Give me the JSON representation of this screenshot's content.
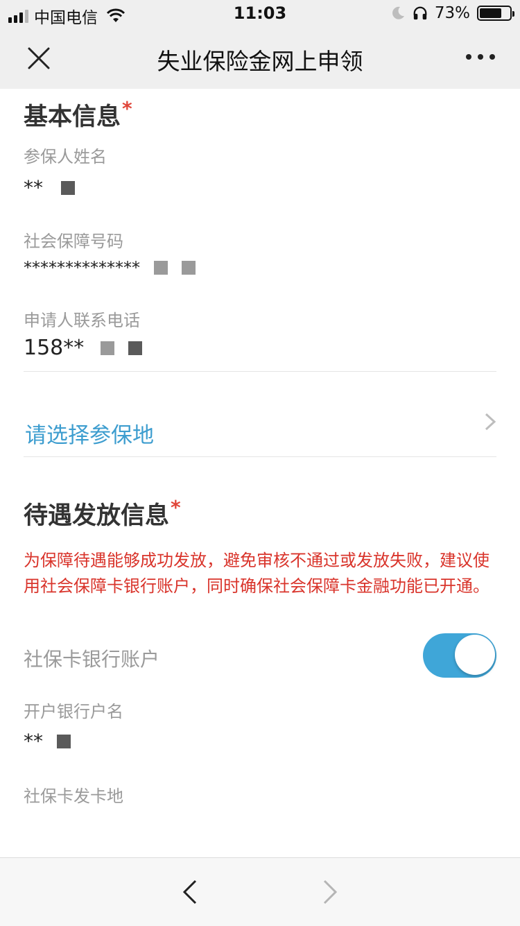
{
  "status_bar": {
    "carrier": "中国电信",
    "time": "11:03",
    "battery_percent": "73%",
    "battery_level": 0.73,
    "icons": [
      "signal-icon",
      "wifi-icon",
      "moon-icon",
      "headphone-icon",
      "battery-icon"
    ]
  },
  "nav": {
    "title": "失业保险金网上申领",
    "close_icon": "close-icon",
    "more_icon": "more-icon"
  },
  "basic_info": {
    "title": "基本信息",
    "required_mark": "*",
    "name_label": "参保人姓名",
    "name_value": "**",
    "ssn_label": "社会保障号码",
    "ssn_value": "**************",
    "phone_label": "申请人联系电话",
    "phone_value": "158**"
  },
  "location_picker": {
    "label": "请选择参保地",
    "icon": "chevron-right-icon"
  },
  "benefit_info": {
    "title": "待遇发放信息",
    "required_mark": "*",
    "notice": "为保障待遇能够成功发放，避免审核不通过或发放失败，建议使用社会保障卡银行账户，同时确保社会保障卡金融功能已开通。",
    "toggle_label": "社保卡银行账户",
    "toggle_on": true,
    "account_name_label": "开户银行户名",
    "account_name_value": "**",
    "card_issuer_label": "社保卡发卡地"
  },
  "bottom_nav": {
    "back_icon": "back-arrow-icon",
    "forward_icon": "forward-arrow-icon"
  },
  "colors": {
    "link_blue": "#3d9dcf",
    "notice_red": "#d9342b",
    "toggle_blue": "#3fa6d8",
    "required_red": "#e0463a"
  }
}
